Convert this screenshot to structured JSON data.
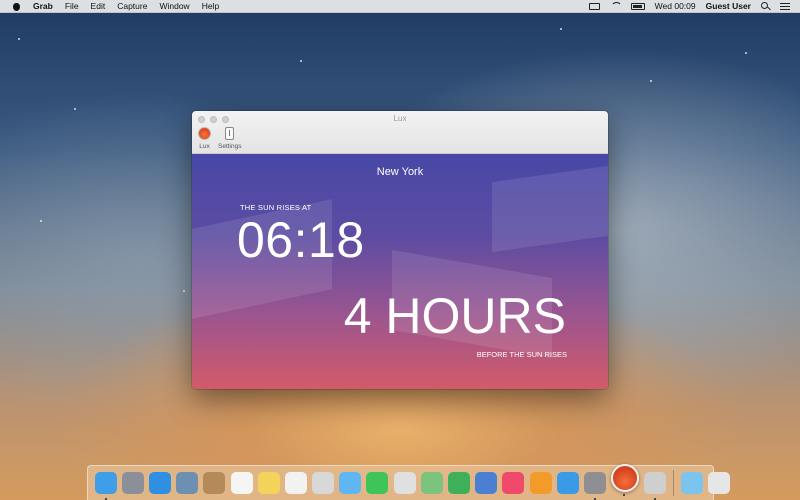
{
  "menubar": {
    "app_name": "Grab",
    "menus": [
      "File",
      "Edit",
      "Capture",
      "Window",
      "Help"
    ],
    "clock": "Wed 00:09",
    "user": "Guest User"
  },
  "window": {
    "title": "Lux",
    "toolbar": [
      {
        "label": "Lux",
        "icon": "sun-icon"
      },
      {
        "label": "Settings",
        "icon": "settings-icon"
      }
    ],
    "city": "New York",
    "sunrise_label": "THE SUN RISES AT",
    "sunrise_time": "06:18",
    "countdown": "4 HOURS",
    "countdown_label": "BEFORE THE SUN RISES"
  },
  "dock": {
    "items": [
      {
        "name": "finder",
        "color": "#3e9ee8",
        "running": true
      },
      {
        "name": "launchpad",
        "color": "#8a8f99",
        "running": false
      },
      {
        "name": "safari",
        "color": "#2f8fe0",
        "running": false
      },
      {
        "name": "mail",
        "color": "#6d8fb2",
        "running": false
      },
      {
        "name": "contacts",
        "color": "#b48a5a",
        "running": false
      },
      {
        "name": "calendar",
        "color": "#f5f5f5",
        "running": false
      },
      {
        "name": "notes",
        "color": "#f3d35a",
        "running": false
      },
      {
        "name": "reminders",
        "color": "#f2f2f2",
        "running": false
      },
      {
        "name": "photo-booth",
        "color": "#d8d8d8",
        "running": false
      },
      {
        "name": "messages",
        "color": "#5fb6f2",
        "running": false
      },
      {
        "name": "facetime",
        "color": "#3fc45a",
        "running": false
      },
      {
        "name": "photos",
        "color": "#e0e0e0",
        "running": false
      },
      {
        "name": "maps",
        "color": "#7cc47d",
        "running": false
      },
      {
        "name": "numbers",
        "color": "#3fb05a",
        "running": false
      },
      {
        "name": "keynote",
        "color": "#4a7fd2",
        "running": false
      },
      {
        "name": "itunes",
        "color": "#f04a6a",
        "running": false
      },
      {
        "name": "ibooks",
        "color": "#f29a2a",
        "running": false
      },
      {
        "name": "app-store",
        "color": "#3a9ae6",
        "running": false
      },
      {
        "name": "system-preferences",
        "color": "#8e8e93",
        "running": true
      }
    ],
    "active_app": "lux",
    "trailing": [
      {
        "name": "grab",
        "color": "#cfcfcf",
        "running": true
      },
      {
        "name": "downloads-folder",
        "color": "#7bc4ee",
        "running": false
      },
      {
        "name": "trash",
        "color": "#e6e6e6",
        "running": false
      }
    ]
  }
}
